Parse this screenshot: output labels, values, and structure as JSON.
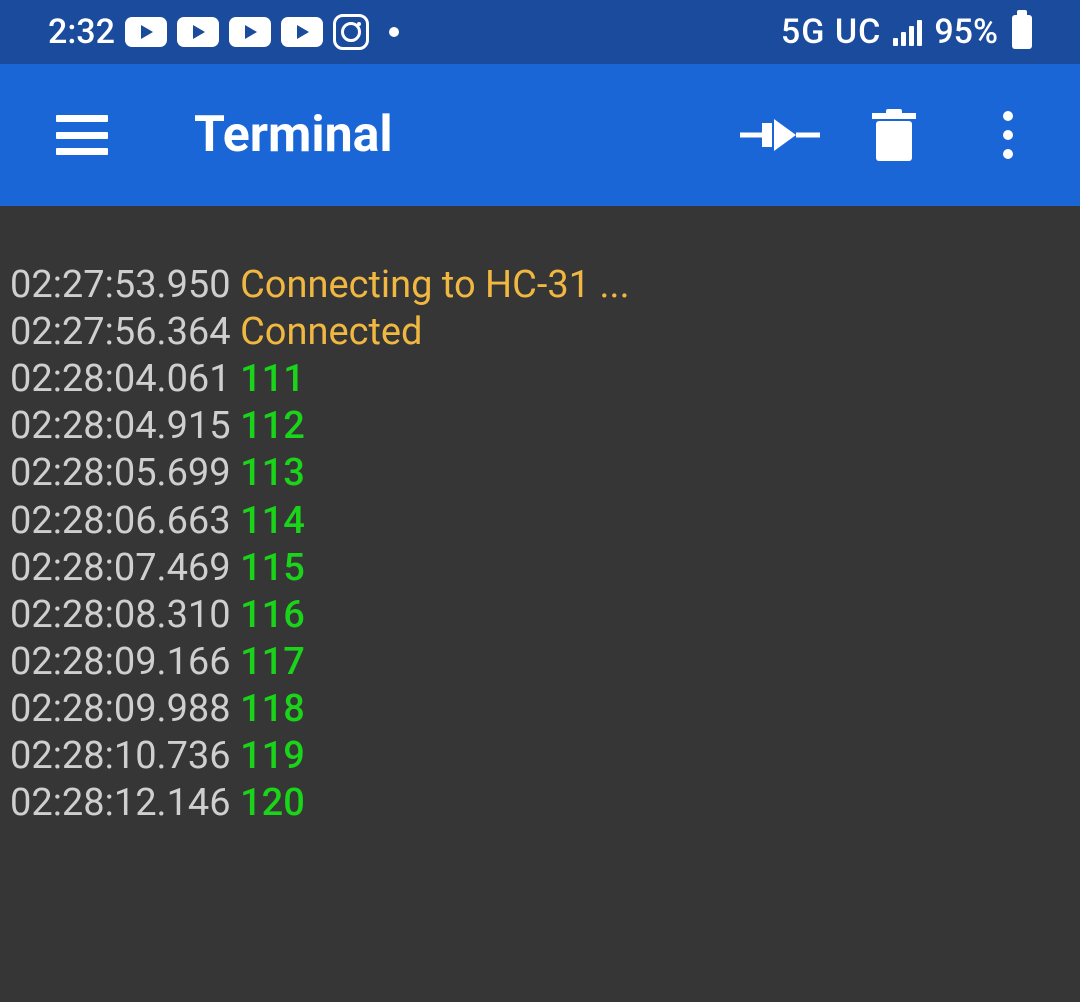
{
  "status_bar": {
    "time": "2:32",
    "network": "5G UC",
    "battery_pct": "95%"
  },
  "app_bar": {
    "title": "Terminal"
  },
  "log": [
    {
      "ts": "02:27:53.950",
      "type": "status",
      "msg": "Connecting to HC-31 ..."
    },
    {
      "ts": "02:27:56.364",
      "type": "status",
      "msg": "Connected"
    },
    {
      "ts": "02:28:04.061",
      "type": "data",
      "msg": "111"
    },
    {
      "ts": "02:28:04.915",
      "type": "data",
      "msg": "112"
    },
    {
      "ts": "02:28:05.699",
      "type": "data",
      "msg": "113"
    },
    {
      "ts": "02:28:06.663",
      "type": "data",
      "msg": "114"
    },
    {
      "ts": "02:28:07.469",
      "type": "data",
      "msg": "115"
    },
    {
      "ts": "02:28:08.310",
      "type": "data",
      "msg": "116"
    },
    {
      "ts": "02:28:09.166",
      "type": "data",
      "msg": "117"
    },
    {
      "ts": "02:28:09.988",
      "type": "data",
      "msg": "118"
    },
    {
      "ts": "02:28:10.736",
      "type": "data",
      "msg": "119"
    },
    {
      "ts": "02:28:12.146",
      "type": "data",
      "msg": "120"
    }
  ]
}
